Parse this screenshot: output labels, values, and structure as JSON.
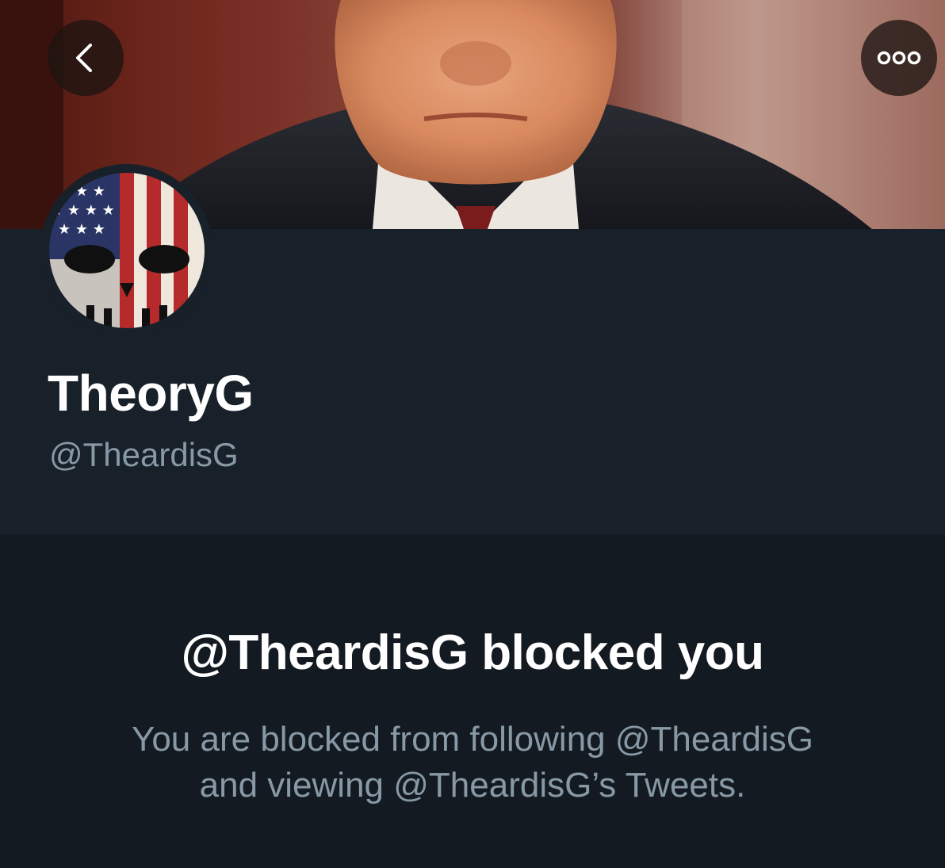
{
  "header": {
    "back_icon": "chevron-left-icon",
    "more_icon": "more-horizontal-icon"
  },
  "profile": {
    "display_name": "TheoryG",
    "handle": "@TheardisG"
  },
  "blocked": {
    "title": "@TheardisG blocked you",
    "description_line1": "You are blocked from following @TheardisG",
    "description_line2": "and viewing @TheardisG’s Tweets."
  },
  "colors": {
    "background": "#141a22",
    "profile_background": "#18202a",
    "primary_text": "#ffffff",
    "secondary_text": "#8899a6"
  }
}
